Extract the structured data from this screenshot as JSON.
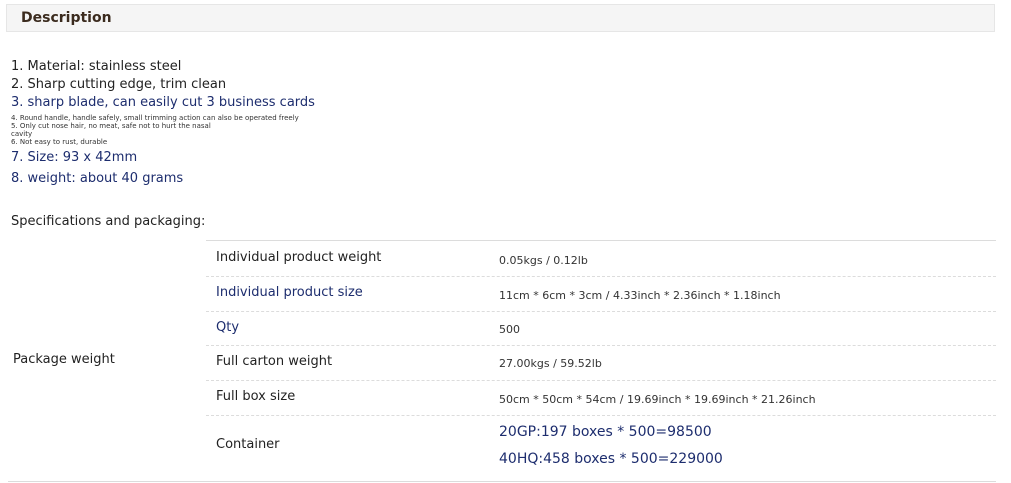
{
  "header": {
    "title": "Description"
  },
  "description": {
    "line1": "1. Material: stainless steel",
    "line2": "2. Sharp cutting edge, trim clean",
    "line3": "3. sharp blade, can easily cut 3 business cards",
    "line4": "4. Round handle, handle safely, small trimming action can also be operated freely",
    "line5": "5. Only cut nose hair, no meat, safe not to hurt the nasal cavity",
    "line6": "6. Not easy to rust, durable",
    "line7": "7. Size: 93 x 42mm",
    "line8": "8. weight: about 40 grams"
  },
  "specs": {
    "title": "Specifications and packaging:",
    "group_label": "Package weight",
    "rows": [
      {
        "key": "Individual product weight",
        "value": "0.05kgs / 0.12lb"
      },
      {
        "key": "Individual product size",
        "value": "11cm * 6cm * 3cm / 4.33inch * 2.36inch * 1.18inch"
      },
      {
        "key": "Qty",
        "value": "500"
      },
      {
        "key": "Full carton weight",
        "value": "27.00kgs / 59.52lb"
      },
      {
        "key": "Full box size",
        "value": "50cm * 50cm * 54cm / 19.69inch * 19.69inch * 21.26inch"
      },
      {
        "key": "Container",
        "value_lines": [
          "20GP:197 boxes * 500=98500",
          "40HQ:458 boxes * 500=229000"
        ]
      }
    ]
  }
}
